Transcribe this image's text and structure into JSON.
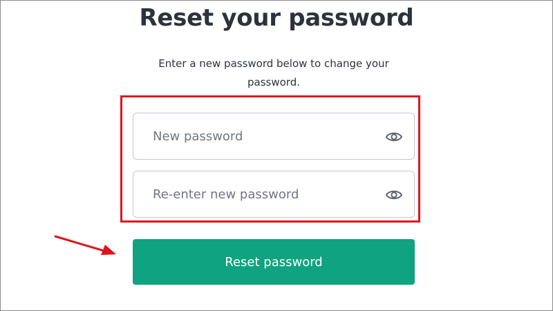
{
  "heading": "Reset your password",
  "description": "Enter a new password below to change your password.",
  "form": {
    "new_password_placeholder": "New password",
    "reenter_password_placeholder": "Re-enter new password",
    "show_password_icon": "eye-icon",
    "submit_label": "Reset password"
  },
  "colors": {
    "primary_button": "#10a37f",
    "annotation_red": "#e0141e",
    "text": "#2d333a"
  }
}
